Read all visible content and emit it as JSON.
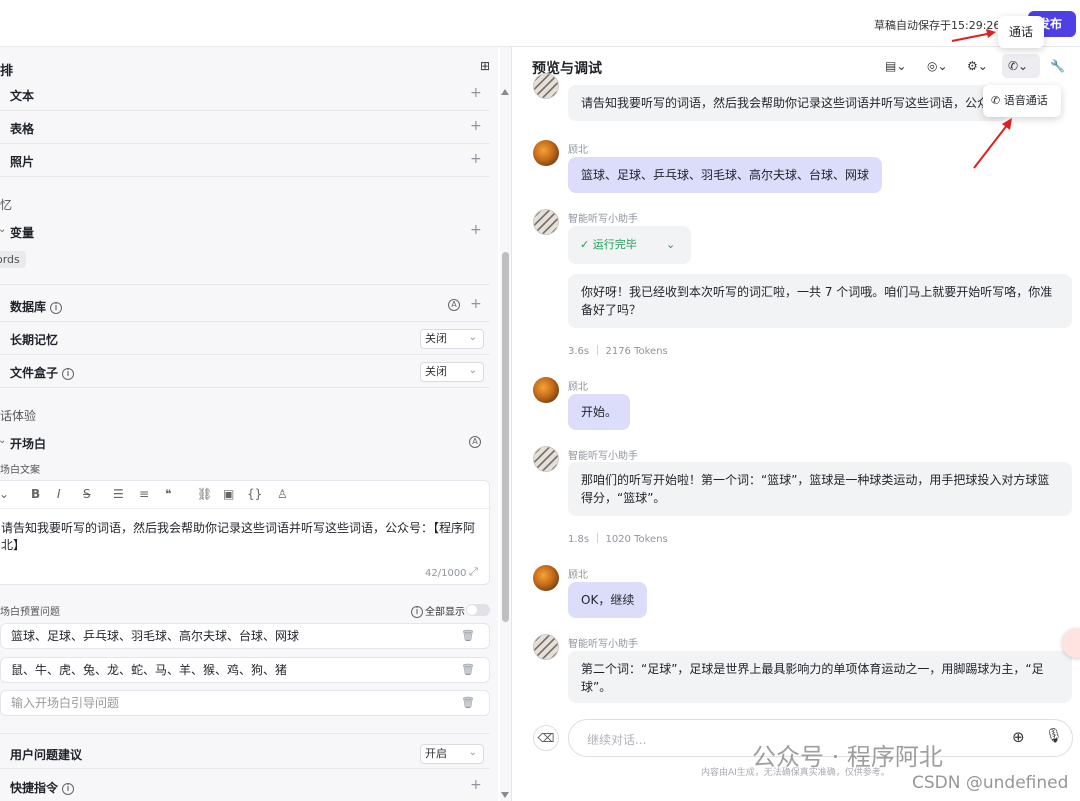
{
  "topbar": {
    "autosave": "草稿自动保存于15:29:26",
    "publish": "发布",
    "call_tooltip": "通话"
  },
  "left": {
    "section_title": "排",
    "items": [
      {
        "label": "文本"
      },
      {
        "label": "表格"
      },
      {
        "label": "照片"
      }
    ],
    "memory_section": "忆",
    "variable_label": "变量",
    "variable_chip": "ords",
    "database_label": "数据库",
    "long_memory_label": "长期记忆",
    "long_memory_value": "关闭",
    "filebox_label": "文件盒子",
    "filebox_value": "关闭",
    "dialog_section": "话体验",
    "opener_label": "开场白",
    "opener_text_label": "场白文案",
    "editor_text": "请告知我要听写的词语，然后我会帮助你记录这些词语并听写这些词语，公众号：【程序阿北】",
    "editor_count": "42/1000",
    "preset_label": "场白预置问题",
    "show_all": "全部显示",
    "questions": [
      "篮球、足球、乒乓球、羽毛球、高尔夫球、台球、网球",
      "鼠、牛、虎、兔、龙、蛇、马、羊、猴、鸡、狗、猪"
    ],
    "question_placeholder": "输入开场白引导问题",
    "suggest_label": "用户问题建议",
    "suggest_value": "开启",
    "shortcut_label": "快捷指令"
  },
  "right": {
    "title": "预览与调试",
    "voice_call": "语音通话",
    "first_bot_message": "请告知我要听写的词语，然后我会帮助你记录这些词语并听写这些词语，公众号：",
    "user_name": "顾北",
    "bot_name": "智能听写小助手",
    "msg_user_1": "篮球、足球、乒乓球、羽毛球、高尔夫球、台球、网球",
    "run_status": "运行完毕",
    "msg_bot_1": "你好呀！我已经收到本次听写的词汇啦，一共 7 个词哦。咱们马上就要开始听写咯，你准备好了吗？",
    "meta_1": "3.6s ｜ 2176 Tokens",
    "msg_user_2": "开始。",
    "msg_bot_2": "那咱们的听写开始啦！第一个词：“篮球”，篮球是一种球类运动，用手把球投入对方球篮得分，“篮球”。",
    "meta_2": "1.8s ｜ 1020 Tokens",
    "msg_user_3": "OK，继续",
    "msg_bot_3": "第二个词：“足球”，足球是世界上最具影响力的单项体育运动之一，用脚踢球为主，“足球”。",
    "input_placeholder": "继续对话...",
    "disclaimer": "内容由AI生成，无法确保真实准确，仅供参考。"
  },
  "watermark": {
    "wechat": "公众号 · 程序阿北",
    "csdn": "CSDN @undefined"
  },
  "colors": {
    "accent": "#4e40e5",
    "user_bubble": "#dcdcfb",
    "bot_bubble": "#f2f3f5",
    "success": "#1f9d55"
  }
}
